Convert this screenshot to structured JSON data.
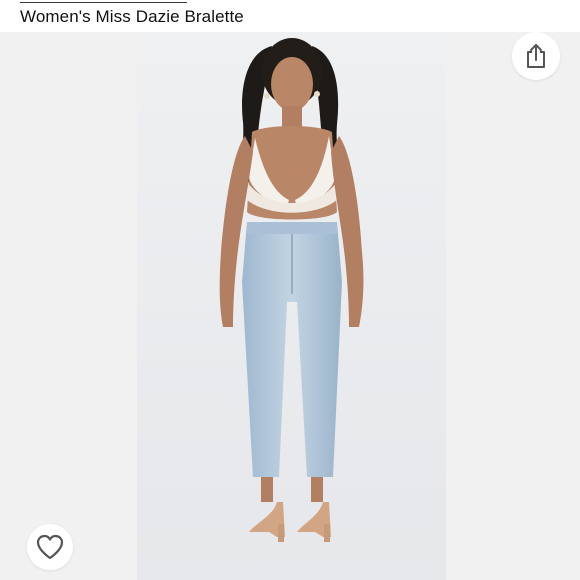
{
  "product": {
    "title": "Women's Miss Dazie Bralette"
  },
  "actions": {
    "share_icon": "share-icon",
    "like_icon": "heart-outline-icon"
  },
  "photo": {
    "subject": "model wearing white lace bralette and light-wash jeans"
  },
  "colors": {
    "page_bg": "#ffffff",
    "side_bg": "#f1f1f1",
    "photo_bg": "#ecedef",
    "icon_stroke": "#555555"
  }
}
